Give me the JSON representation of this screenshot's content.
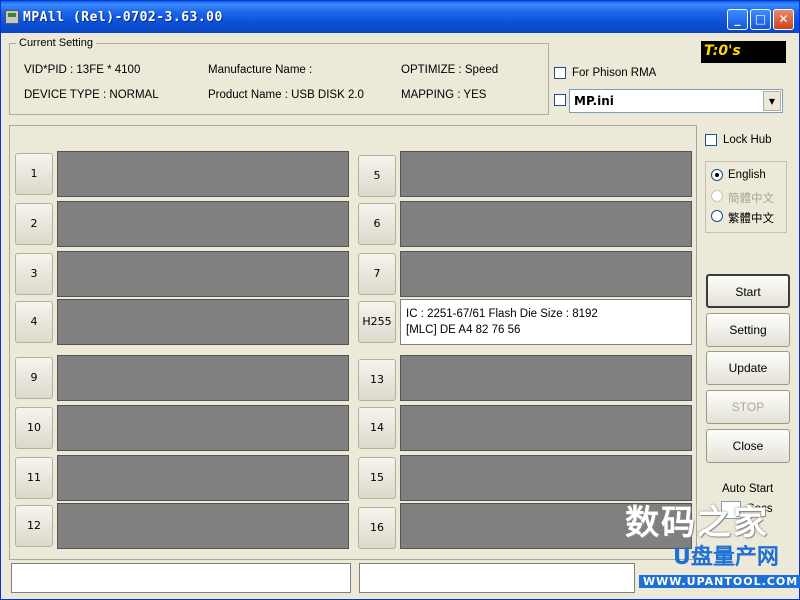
{
  "window": {
    "title": "MPAll (Rel)-0702-3.63.00",
    "buttons": {
      "minimize": "_",
      "maximize": "□",
      "close": "✕"
    }
  },
  "current_setting": {
    "legend": "Current Setting",
    "vid_pid": "VID*PID : 13FE * 4100",
    "device_type": "DEVICE TYPE : NORMAL",
    "manufacture_name": "Manufacture Name :",
    "product_name": "Product Name : USB DISK 2.0",
    "optimize": "OPTIMIZE : Speed",
    "mapping": "MAPPING : YES"
  },
  "timer": "T:0's",
  "for_phison_rma": {
    "label": "For Phison RMA",
    "checked": false
  },
  "ini_combo": {
    "value": "MP.ini",
    "checked": false
  },
  "lock_hub": {
    "label": "Lock Hub",
    "checked": false
  },
  "languages": [
    {
      "label": "English",
      "selected": true,
      "enabled": true
    },
    {
      "label": "簡體中文",
      "selected": false,
      "enabled": false
    },
    {
      "label": "繁體中文",
      "selected": false,
      "enabled": true
    }
  ],
  "ports_left": [
    "1",
    "2",
    "3",
    "4",
    "9",
    "10",
    "11",
    "12"
  ],
  "ports_right": [
    "5",
    "6",
    "7",
    "H255",
    "13",
    "14",
    "15",
    "16"
  ],
  "active_port": {
    "line1": "IC : 2251-67/61  Flash Die Size : 8192",
    "line2": "[MLC] DE A4 82 76 56"
  },
  "actions": {
    "start": "Start",
    "setting": "Setting",
    "update": "Update",
    "stop": "STOP",
    "close": "Close"
  },
  "auto_start": {
    "label": "Auto Start",
    "unit": "Secs"
  },
  "watermark": {
    "line1": "数码之家",
    "line2": "U盘量产网",
    "url": "WWW.UPANTOOL.COM"
  }
}
